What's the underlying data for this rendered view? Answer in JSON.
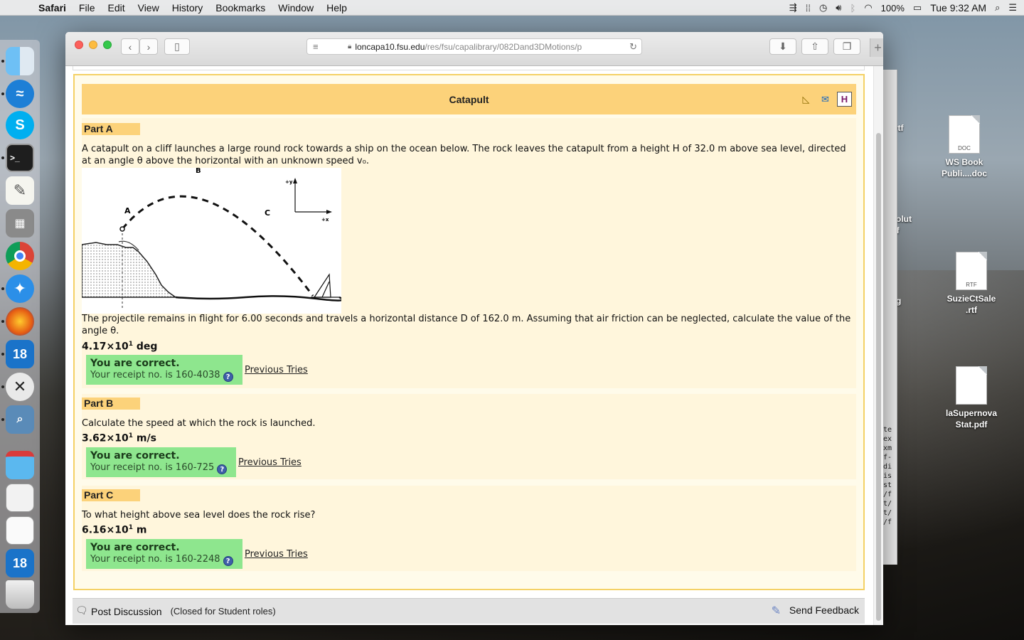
{
  "menubar": {
    "app": "Safari",
    "items": [
      "File",
      "Edit",
      "View",
      "History",
      "Bookmarks",
      "Window",
      "Help"
    ],
    "battery": "100%",
    "clock": "Tue 9:32 AM"
  },
  "browser": {
    "url_host": "loncapa10.fsu.edu",
    "url_path": "/res/fsu/capalibrary/082Dand3DMotions/p"
  },
  "problem": {
    "title": "Catapult",
    "parts": [
      {
        "label": "Part A",
        "question": "A catapult on a cliff launches a large round rock towards a ship on the ocean below. The rock leaves the catapult from a height H of 32.0 m above sea level, directed at an angle θ above the horizontal with an unknown speed v₀.",
        "question2": "The projectile remains in flight for 6.00 seconds and travels a horizontal distance D of 162.0 m. Assuming that air friction can be neglected, calculate the value of the angle θ.",
        "answer_mantissa": "4.17×10",
        "answer_exp": "1",
        "answer_unit": "deg",
        "status": "You are correct.",
        "receipt": "Your receipt no. is 160-4038",
        "previous": "Previous Tries"
      },
      {
        "label": "Part B",
        "question": "Calculate the speed at which the rock is launched.",
        "answer_mantissa": "3.62×10",
        "answer_exp": "1",
        "answer_unit": "m/s",
        "status": "You are correct.",
        "receipt": "Your receipt no. is 160-725",
        "previous": "Previous Tries"
      },
      {
        "label": "Part C",
        "question": "To what height above sea level does the rock rise?",
        "answer_mantissa": "6.16×10",
        "answer_exp": "1",
        "answer_unit": "m",
        "status": "You are correct.",
        "receipt": "Your receipt no. is 160-2248",
        "previous": "Previous Tries"
      }
    ],
    "diagram_labels": {
      "a": "A",
      "b": "B",
      "c": "C",
      "y": "+y",
      "x": "+x"
    }
  },
  "footer": {
    "post_discussion": "Post Discussion",
    "closed_note": "(Closed for Student roles)",
    "send_feedback": "Send Feedback"
  },
  "desktop": {
    "files": [
      {
        "name": "WS Book Publi....doc",
        "type": "DOC"
      },
      {
        "name": "SuzieCtSale .rtf",
        "type": "RTF"
      },
      {
        "name": "laSupernova Stat.pdf",
        "type": ""
      }
    ],
    "partial_labels": [
      "ky.rtf",
      "leSolut s.rtf",
      ".png"
    ],
    "partial_text": [
      "te",
      "ex",
      "xm",
      "f-",
      "di",
      "is",
      "st",
      "/f",
      "t/",
      "t/",
      "/f"
    ]
  },
  "dock": {
    "badge": "18"
  },
  "colors": {
    "title_bar": "#fcd27a",
    "correct_bg": "#8ee68e",
    "problem_border": "#f4d166"
  }
}
